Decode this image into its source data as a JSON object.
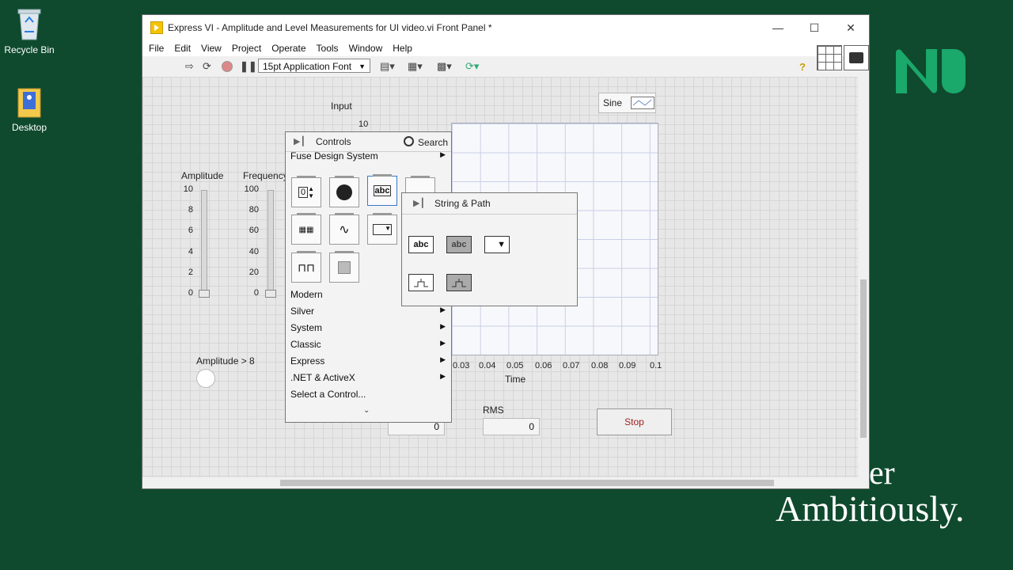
{
  "desktop": {
    "icons": [
      {
        "label": "Recycle Bin"
      },
      {
        "label": "Desktop"
      }
    ],
    "tagline_line1": "er",
    "tagline_line2": "Ambitiously."
  },
  "window": {
    "title": "Express VI - Amplitude and Level Measurements for UI video.vi Front Panel *",
    "menu": [
      "File",
      "Edit",
      "View",
      "Project",
      "Operate",
      "Tools",
      "Window",
      "Help"
    ],
    "font_select": "15pt Application Font"
  },
  "panel": {
    "input_label": "Input",
    "graph_y_top": "10",
    "amplitude_label": "Amplitude",
    "frequency_label": "Frequency",
    "amplitude_ticks": [
      "10",
      "8",
      "6",
      "4",
      "2",
      "0"
    ],
    "frequency_ticks": [
      "100",
      "80",
      "60",
      "40",
      "20",
      "0"
    ],
    "amplitude_gt_label": "Amplitude > 8",
    "signal_type": "Sine",
    "x_ticks": [
      "0.03",
      "0.04",
      "0.05",
      "0.06",
      "0.07",
      "0.08",
      "0.09",
      "0.1"
    ],
    "x_axis_label": "Time",
    "rms_label": "RMS",
    "rms_value": "0",
    "other_value": "0",
    "stop_label": "Stop"
  },
  "palette": {
    "title": "Controls",
    "search_label": "Search",
    "categories_top": [
      "Fuse Design System"
    ],
    "categories": [
      "Modern",
      "Silver",
      "System",
      "Classic",
      "Express",
      ".NET & ActiveX",
      "Select a Control..."
    ],
    "submenu_title": "String & Path",
    "abc_label": "abc"
  }
}
